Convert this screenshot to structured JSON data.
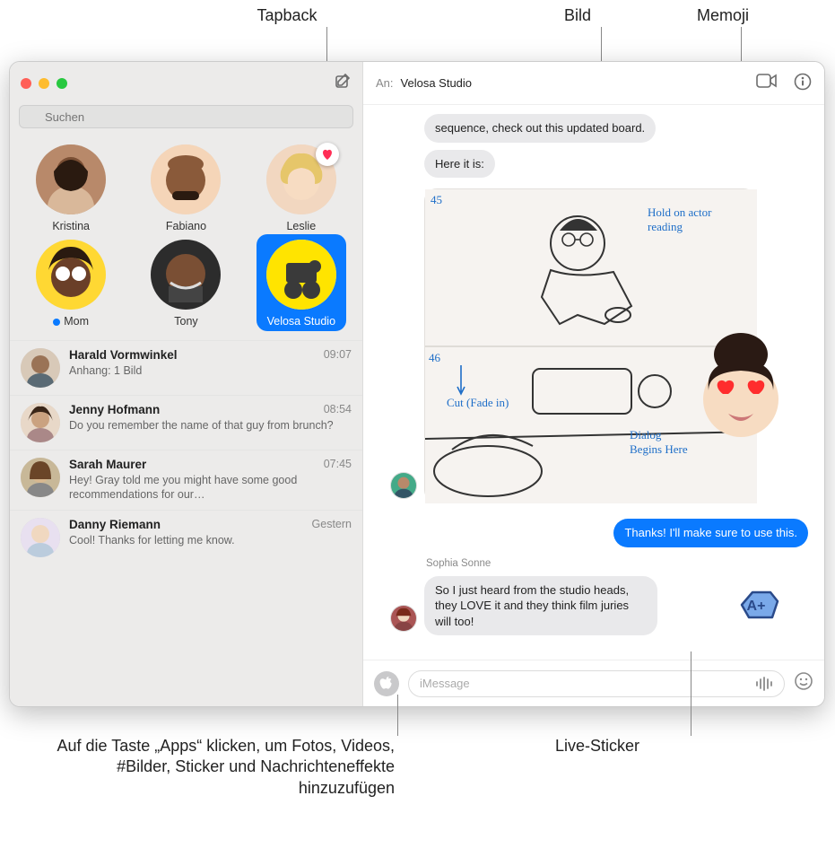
{
  "callouts": {
    "tapback": "Tapback",
    "bild": "Bild",
    "memoji": "Memoji",
    "apps_text": "Auf die Taste „Apps“ klicken, um Fotos, Videos, #Bilder, Sticker und Nachrichteneffekte hinzuzufügen",
    "live_sticker": "Live-Sticker"
  },
  "search": {
    "placeholder": "Suchen"
  },
  "header": {
    "an_label": "An:",
    "title": "Velosa Studio"
  },
  "pins": [
    {
      "name": "Kristina",
      "has_unread": false,
      "has_tapback": false
    },
    {
      "name": "Fabiano",
      "has_unread": false,
      "has_tapback": false
    },
    {
      "name": "Leslie",
      "has_unread": false,
      "has_tapback": true
    },
    {
      "name": "Mom",
      "has_unread": true,
      "has_tapback": false
    },
    {
      "name": "Tony",
      "has_unread": false,
      "has_tapback": false
    },
    {
      "name": "Velosa Studio",
      "has_unread": false,
      "has_tapback": false,
      "selected": true
    }
  ],
  "conversations": [
    {
      "name": "Harald Vormwinkel",
      "time": "09:07",
      "preview": "Anhang: 1 Bild"
    },
    {
      "name": "Jenny Hofmann",
      "time": "08:54",
      "preview": "Do you remember the name of that guy from brunch?"
    },
    {
      "name": "Sarah Maurer",
      "time": "07:45",
      "preview": "Hey! Gray told me you might have some good recommendations for our…"
    },
    {
      "name": "Danny Riemann",
      "time": "Gestern",
      "preview": "Cool! Thanks for letting me know."
    }
  ],
  "chat": {
    "msg0": "sequence, check out this updated board.",
    "msg1": "Here it is:",
    "image_annotations": {
      "tl_num": "45",
      "tr": "Hold on actor reading",
      "ml_num": "46",
      "ml": "Cut (Fade in)",
      "br": "Dialog Begins Here"
    },
    "msg_out": "Thanks! I'll make sure to use this.",
    "sender2": "Sophia Sonne",
    "msg2": "So I just heard from the studio heads, they LOVE it and they think film juries will too!",
    "sticker_text": "A+"
  },
  "composer": {
    "placeholder": "iMessage"
  },
  "tapback_heart_color": "#ff2d55"
}
